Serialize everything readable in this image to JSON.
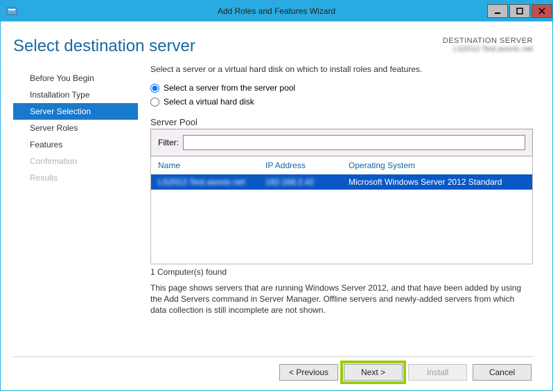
{
  "titlebar": {
    "title": "Add Roles and Features Wizard"
  },
  "header": {
    "title": "Select destination server",
    "dest_label": "DESTINATION SERVER",
    "dest_server": "LS2012-Test.axonic.net"
  },
  "nav": {
    "items": [
      {
        "label": "Before You Begin",
        "state": "normal"
      },
      {
        "label": "Installation Type",
        "state": "normal"
      },
      {
        "label": "Server Selection",
        "state": "active"
      },
      {
        "label": "Server Roles",
        "state": "normal"
      },
      {
        "label": "Features",
        "state": "normal"
      },
      {
        "label": "Confirmation",
        "state": "disabled"
      },
      {
        "label": "Results",
        "state": "disabled"
      }
    ]
  },
  "main": {
    "instruction": "Select a server or a virtual hard disk on which to install roles and features.",
    "radio_pool": "Select a server from the server pool",
    "radio_vhd": "Select a virtual hard disk",
    "pool_section": "Server Pool",
    "filter_label": "Filter:",
    "filter_value": "",
    "columns": {
      "name": "Name",
      "ip": "IP Address",
      "os": "Operating System"
    },
    "rows": [
      {
        "name": "LS2012-Test.axonic.net",
        "ip": "192.168.2.42",
        "os": "Microsoft Windows Server 2012 Standard",
        "selected": true
      }
    ],
    "found": "1 Computer(s) found",
    "note": "This page shows servers that are running Windows Server 2012, and that have been added by using the Add Servers command in Server Manager. Offline servers and newly-added servers from which data collection is still incomplete are not shown."
  },
  "buttons": {
    "previous": "< Previous",
    "next": "Next >",
    "install": "Install",
    "cancel": "Cancel"
  }
}
